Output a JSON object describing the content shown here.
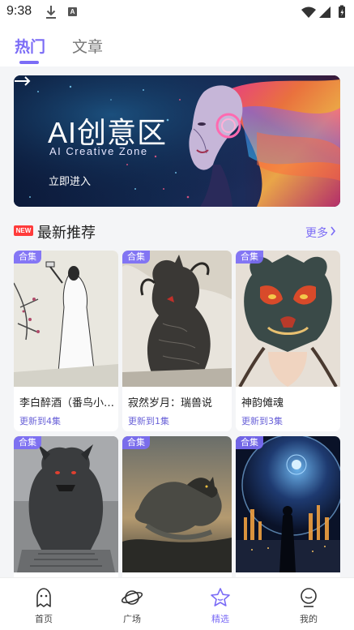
{
  "status_bar": {
    "time": "9:38",
    "a_badge": "A"
  },
  "tabs": [
    {
      "label": "热门",
      "active": true
    },
    {
      "label": "文章",
      "active": false
    }
  ],
  "banner": {
    "title": "AI创意区",
    "subtitle": "AI Creative Zone",
    "cta": "立即进入"
  },
  "section": {
    "badge": "NEW",
    "title": "最新推荐",
    "more": "更多"
  },
  "cards": [
    {
      "tag": "合集",
      "title": "李白醉酒（番鸟小…",
      "update": "更新到4集"
    },
    {
      "tag": "合集",
      "title": "寂然岁月：瑞兽说",
      "update": "更新到1集"
    },
    {
      "tag": "合集",
      "title": "神韵傩魂",
      "update": "更新到3集"
    },
    {
      "tag": "合集",
      "title": "",
      "update": ""
    },
    {
      "tag": "合集",
      "title": "",
      "update": ""
    },
    {
      "tag": "合集",
      "title": "",
      "update": ""
    }
  ],
  "bottom_nav": [
    {
      "label": "首页",
      "icon": "home-icon",
      "active": false
    },
    {
      "label": "广场",
      "icon": "planet-icon",
      "active": false
    },
    {
      "label": "精选",
      "icon": "star-icon",
      "active": true
    },
    {
      "label": "我的",
      "icon": "profile-icon",
      "active": false
    }
  ],
  "colors": {
    "accent": "#7b6cf6",
    "new_badge": "#ff3b3b"
  }
}
